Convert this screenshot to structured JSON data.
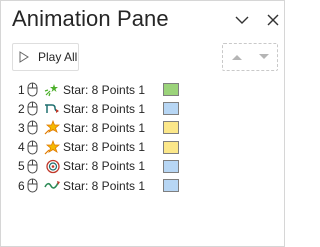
{
  "pane": {
    "title": "Animation Pane",
    "collapse_icon": "chevron-down-icon",
    "close_icon": "close-icon"
  },
  "toolbar": {
    "play_all_label": "Play All",
    "play_icon": "play-icon",
    "move_up_icon": "triangle-up-icon",
    "move_down_icon": "triangle-down-icon"
  },
  "animations": [
    {
      "number": "1",
      "label": "Star: 8 Points 1",
      "trigger_icon": "mouse-click-icon",
      "effect_icon": "sparkle-burst-icon",
      "bar_color": "#9bd37a"
    },
    {
      "number": "2",
      "label": "Star: 8 Points 1",
      "trigger_icon": "mouse-click-icon",
      "effect_icon": "motion-path-icon",
      "bar_color": "#b7d6f4"
    },
    {
      "number": "3",
      "label": "Star: 8 Points 1",
      "trigger_icon": "mouse-click-icon",
      "effect_icon": "emphasis-star-icon",
      "bar_color": "#fbe78a"
    },
    {
      "number": "4",
      "label": "Star: 8 Points 1",
      "trigger_icon": "mouse-click-icon",
      "effect_icon": "emphasis-star-icon",
      "bar_color": "#fbe78a"
    },
    {
      "number": "5",
      "label": "Star: 8 Points 1",
      "trigger_icon": "mouse-click-icon",
      "effect_icon": "spiral-path-icon",
      "bar_color": "#b7d6f4"
    },
    {
      "number": "6",
      "label": "Star: 8 Points 1",
      "trigger_icon": "mouse-click-icon",
      "effect_icon": "wave-path-icon",
      "bar_color": "#b7d6f4"
    }
  ]
}
